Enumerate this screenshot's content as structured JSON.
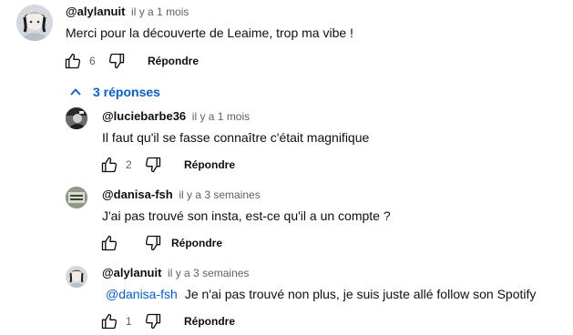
{
  "comments": [
    {
      "author": "@alylanuit",
      "time": "il y a 1 mois",
      "text": "Merci pour la découverte de Leaime, trop ma vibe !",
      "likes": "6",
      "reply_label": "Répondre"
    }
  ],
  "replies_toggle": {
    "label": "3 réponses"
  },
  "replies": [
    {
      "author": "@luciebarbe36",
      "time": "il y a 1 mois",
      "text": "Il faut qu'il se fasse connaître c'était magnifique",
      "likes": "2",
      "reply_label": "Répondre"
    },
    {
      "author": "@danisa-fsh",
      "time": "il y a 3 semaines",
      "text": "J'ai pas trouvé son insta, est-ce qu'il a un compte ?",
      "likes": "",
      "reply_label": "Répondre"
    },
    {
      "author": "@alylanuit",
      "time": "il y a 3 semaines",
      "mention": "@danisa-fsh",
      "text": "Je n'ai pas trouvé non plus, je suis juste allé follow son Spotify",
      "likes": "1",
      "reply_label": "Répondre"
    }
  ],
  "icons": {
    "like": "thumbs-up-icon",
    "dislike": "thumbs-down-icon",
    "toggle": "chevron-up-icon"
  },
  "colors": {
    "link": "#065fd4",
    "secondary_text": "#606060"
  }
}
